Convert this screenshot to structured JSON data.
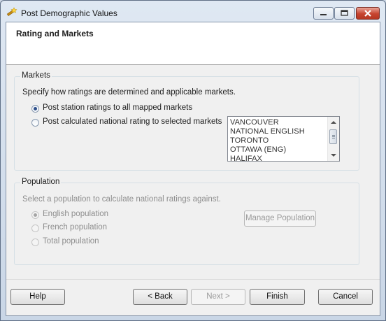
{
  "window": {
    "title": "Post Demographic Values"
  },
  "header": {
    "title": "Rating and Markets"
  },
  "markets": {
    "label": "Markets",
    "description": "Specify how ratings are determined and applicable markets.",
    "option_station": "Post station ratings to all mapped markets",
    "option_national": "Post calculated national rating to selected markets",
    "selected_option": "station",
    "list": [
      "VANCOUVER",
      "NATIONAL ENGLISH",
      "TORONTO",
      "OTTAWA (ENG)",
      "HALIFAX"
    ]
  },
  "population": {
    "label": "Population",
    "description": "Select a population to calculate national ratings against.",
    "options": [
      "English population",
      "French population",
      "Total population"
    ],
    "selected_option": "English population",
    "manage_button": "Manage Population"
  },
  "footer": {
    "help": "Help",
    "back": "< Back",
    "next": "Next >",
    "finish": "Finish",
    "cancel": "Cancel"
  },
  "icons": {
    "app": "wizard-wand-icon"
  }
}
